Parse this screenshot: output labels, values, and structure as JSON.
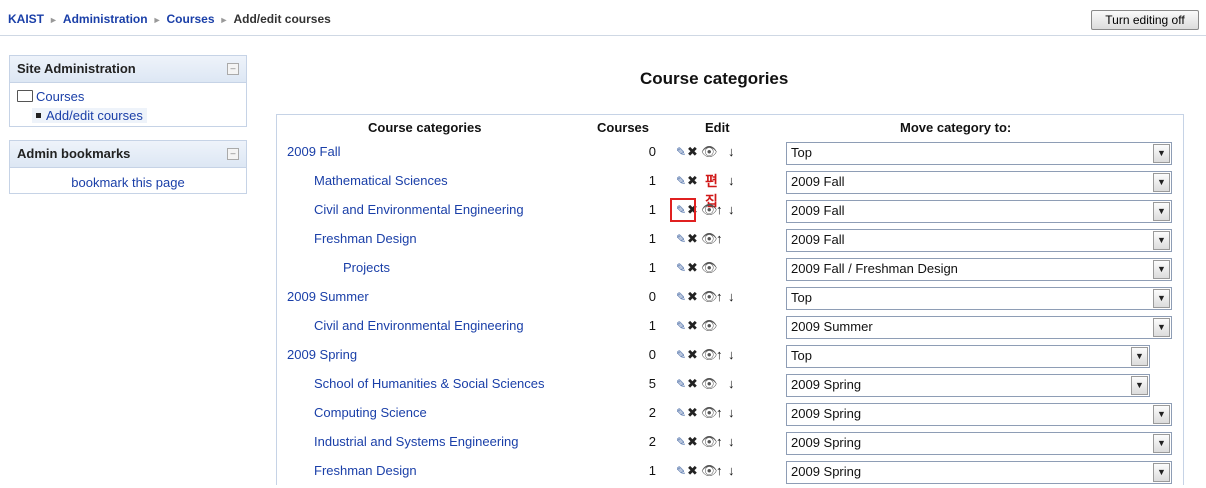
{
  "breadcrumb": [
    "KAIST",
    "Administration",
    "Courses",
    "Add/edit courses"
  ],
  "breadcrumb_sep": "►",
  "turn_editing": "Turn editing off",
  "site_admin": {
    "title": "Site Administration",
    "toggle": "–",
    "courses": "Courses",
    "addedit": "Add/edit courses"
  },
  "admin_bookmarks": {
    "title": "Admin bookmarks",
    "toggle": "–",
    "link": "bookmark this page"
  },
  "page_title": "Course categories",
  "headers": {
    "categories": "Course categories",
    "courses": "Courses",
    "edit": "Edit",
    "move": "Move category to:"
  },
  "annotation": "편집",
  "icons": {
    "edit": "✎",
    "delete": "✖",
    "hide": "👁",
    "up": "↑",
    "down": "↓",
    "dropdown": "▼"
  },
  "rows": [
    {
      "name": "2009 Fall",
      "count": "0",
      "move": "Top"
    },
    {
      "name": "Mathematical Sciences",
      "count": "1",
      "move": "2009 Fall"
    },
    {
      "name": "Civil and Environmental Engineering",
      "count": "1",
      "move": "2009 Fall"
    },
    {
      "name": "Freshman Design",
      "count": "1",
      "move": "2009 Fall"
    },
    {
      "name": "Projects",
      "count": "1",
      "move": "2009 Fall / Freshman Design"
    },
    {
      "name": "2009 Summer",
      "count": "0",
      "move": "Top"
    },
    {
      "name": "Civil and Environmental Engineering",
      "count": "1",
      "move": "2009 Summer"
    },
    {
      "name": "2009 Spring",
      "count": "0",
      "move": "Top"
    },
    {
      "name": "School of Humanities & Social Sciences",
      "count": "5",
      "move": "2009 Spring"
    },
    {
      "name": "Computing Science",
      "count": "2",
      "move": "2009 Spring"
    },
    {
      "name": "Industrial and Systems Engineering",
      "count": "2",
      "move": "2009 Spring"
    },
    {
      "name": "Freshman Design",
      "count": "1",
      "move": "2009 Spring"
    }
  ],
  "colors": {
    "link": "#1a3fa8",
    "delete": "#d01818",
    "highlight": "#e02020"
  }
}
